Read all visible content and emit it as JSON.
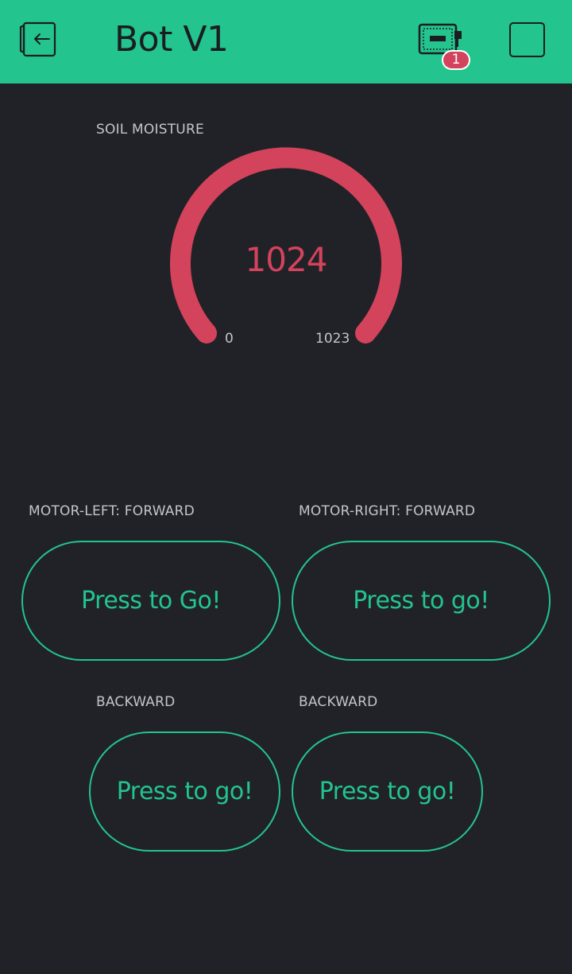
{
  "header": {
    "title": "Bot V1",
    "device_badge_count": "1",
    "accent_color": "#23c48e",
    "icons": {
      "back": "exit-to-left-icon",
      "device": "device-board-icon",
      "stop": "stop-square-icon"
    }
  },
  "gauge": {
    "label": "SOIL MOISTURE",
    "value": "1024",
    "min": "0",
    "max": "1023",
    "color": "#d3435c"
  },
  "controls": {
    "motor_left_label": "MOTOR-LEFT: FORWARD",
    "motor_left_button": "Press to Go!",
    "motor_right_label": "MOTOR-RIGHT: FORWARD",
    "motor_right_button": "Press to go!",
    "backward_left_label": "BACKWARD",
    "backward_left_button": "Press to go!",
    "backward_right_label": "BACKWARD",
    "backward_right_button": "Press to go!",
    "button_color": "#23c48e"
  }
}
